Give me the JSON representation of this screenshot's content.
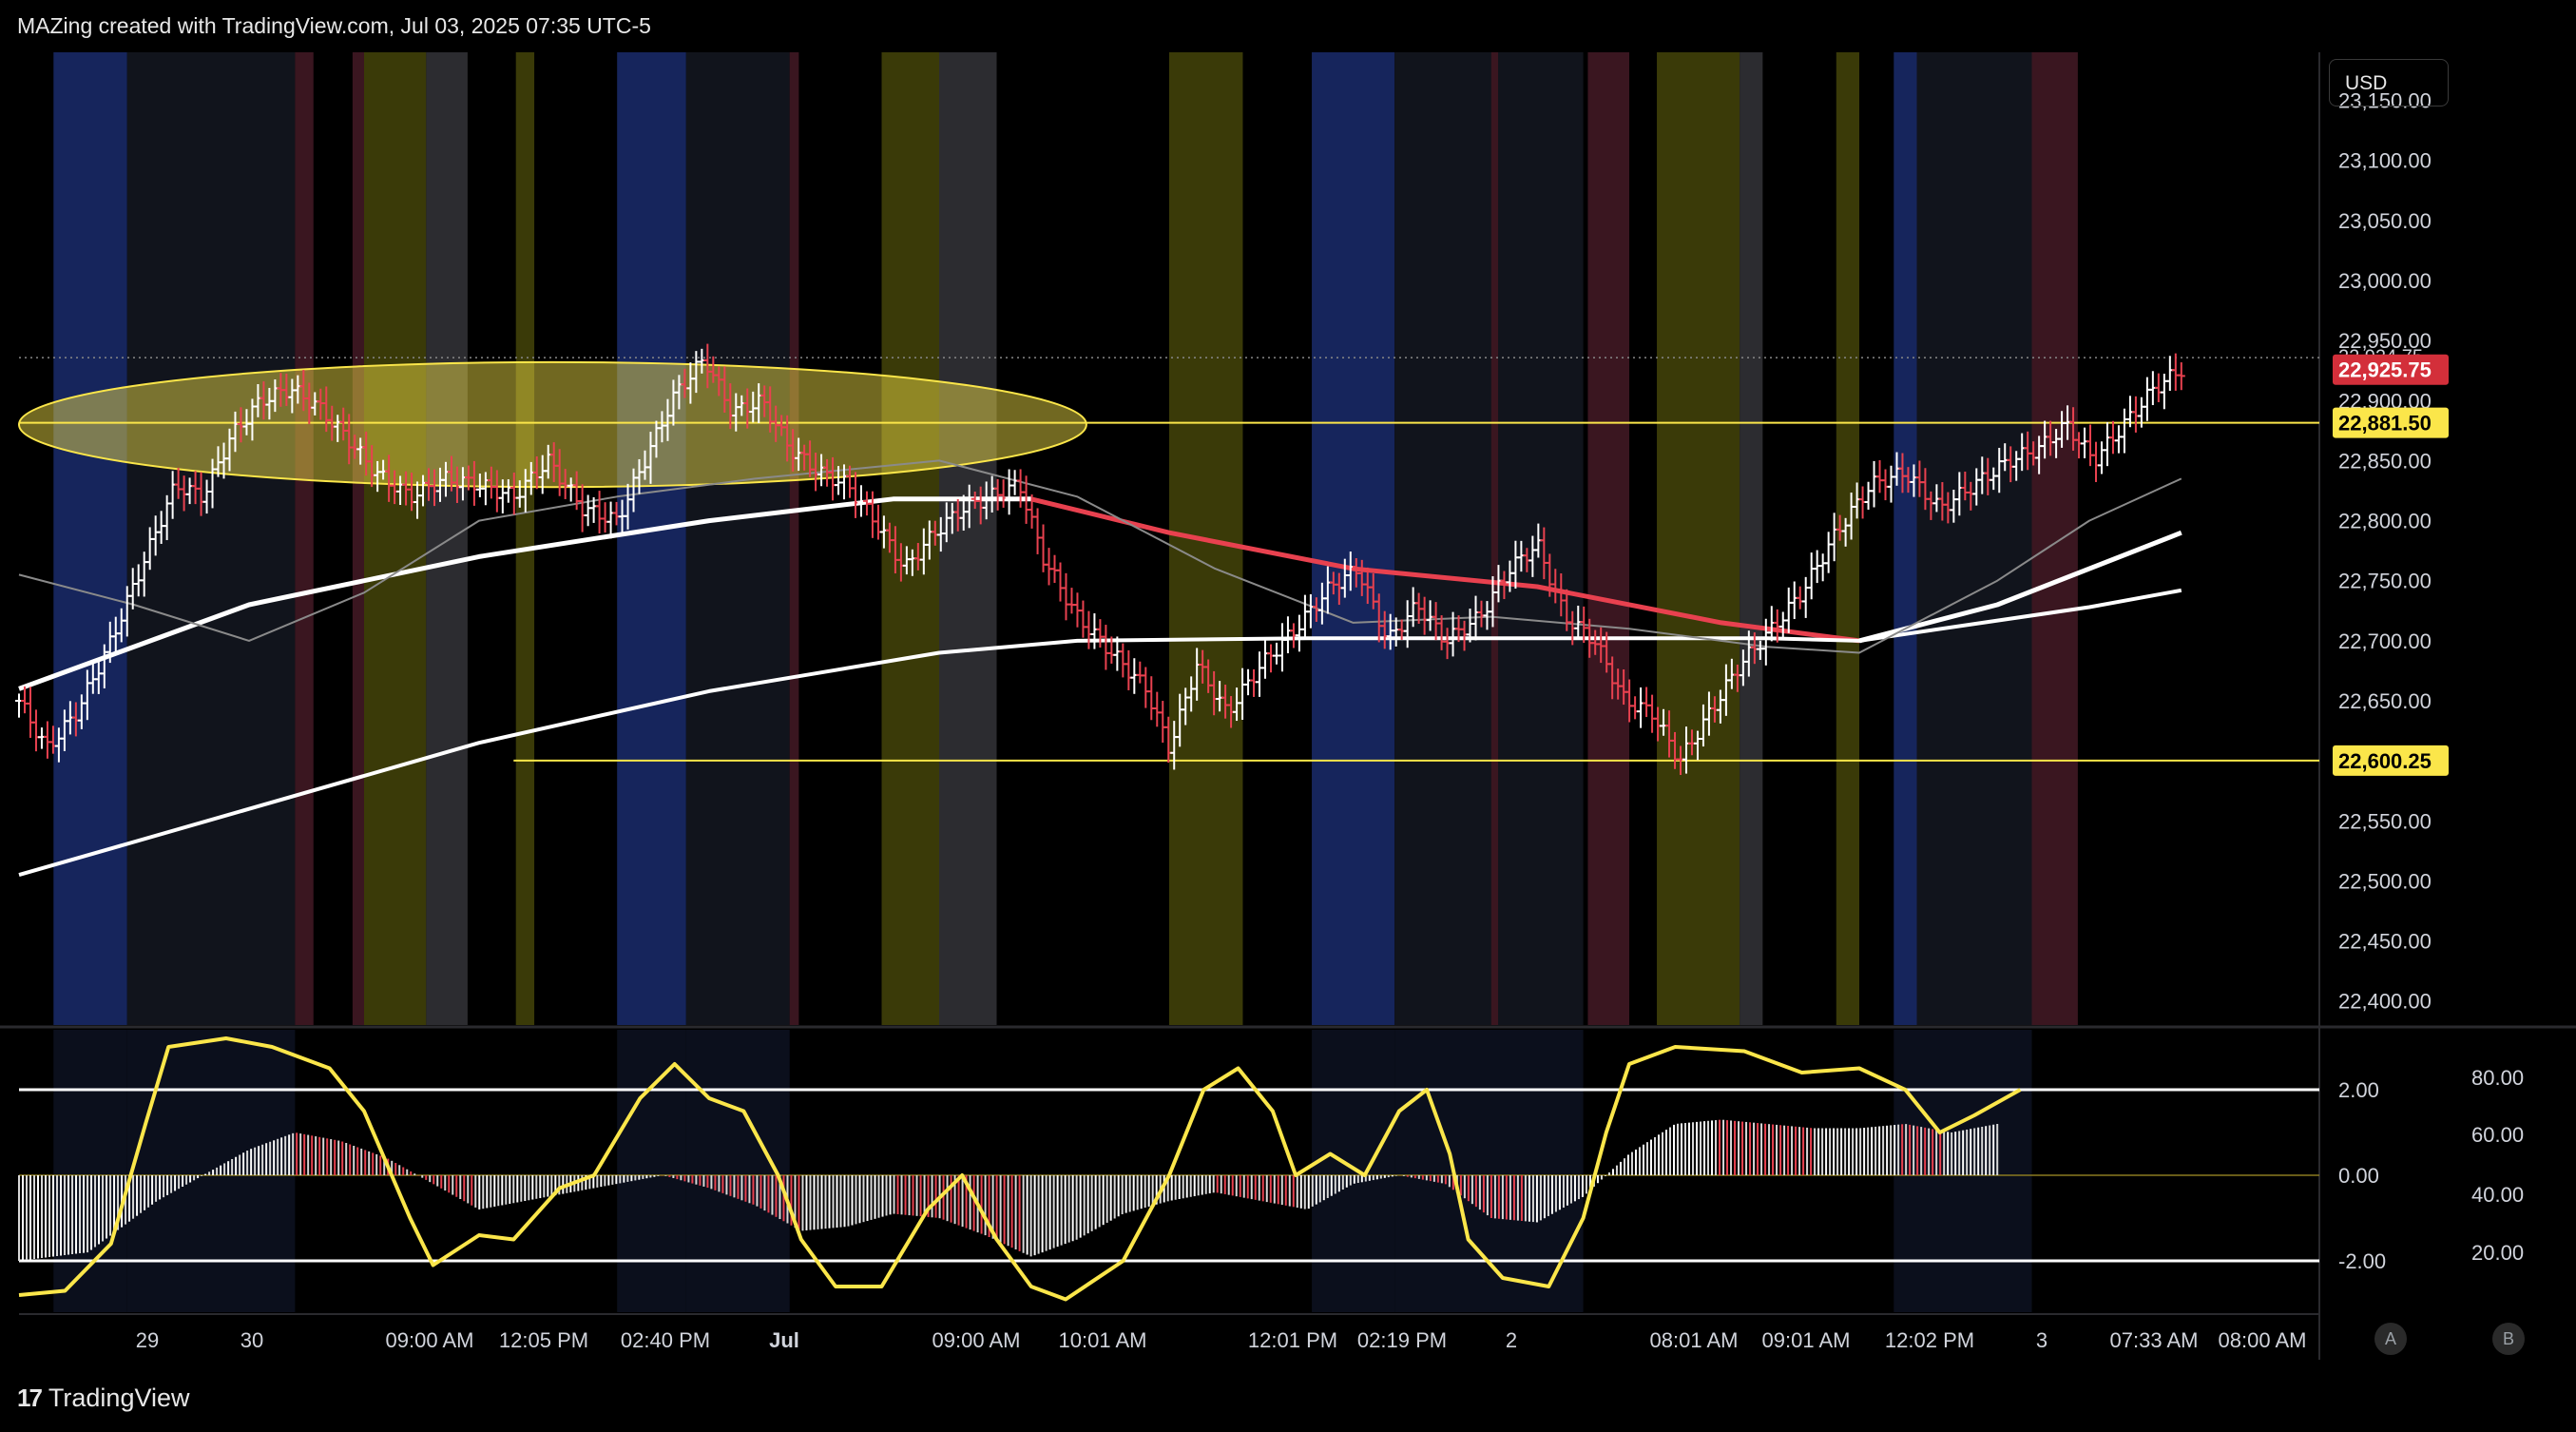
{
  "header": {
    "title": "MAZing created with TradingView.com, Jul 03, 2025 07:35 UTC-5"
  },
  "brand": {
    "name": "TradingView",
    "logo_icon": "tradingview-logo-icon"
  },
  "currency": "USD",
  "scale_buttons": [
    "A",
    "B"
  ],
  "colors": {
    "background": "#000000",
    "price_label_red": "#d32f3a",
    "price_label_yellow": "#fbe64a",
    "yellow": "#fbe64a",
    "red": "#e8414f",
    "white": "#ffffff",
    "blue_band": "#16255c",
    "yellow_band": "#3a3a08",
    "gray_band": "#2c2c30",
    "red_band": "#3a1620"
  },
  "chart_data": [
    {
      "type": "bar",
      "title": "",
      "description_note": "",
      "ylim": [
        22380,
        23190
      ],
      "y_ticks": [
        "23,150.00",
        "23,100.00",
        "23,050.00",
        "23,000.00",
        "22,950.00",
        "22,900.00",
        "22,850.00",
        "22,800.00",
        "22,750.00",
        "22,700.00",
        "22,650.00",
        "22,600.00",
        "22,550.00",
        "22,500.00",
        "22,450.00",
        "22,400.00"
      ],
      "x_ticks": [
        "29",
        "30",
        "09:00 AM",
        "12:05 PM",
        "02:40 PM",
        "Jul",
        "09:00 AM",
        "10:01 AM",
        "12:01 PM",
        "02:19 PM",
        "2",
        "08:01 AM",
        "09:01 AM",
        "12:02 PM",
        "3",
        "07:33 AM",
        "08:00 AM"
      ],
      "price_labels": [
        {
          "text": "22,925.75",
          "value": 22925.75,
          "style": "red"
        },
        {
          "text": "22,881.50",
          "value": 22881.5,
          "style": "yellow"
        },
        {
          "text": "22,600.25",
          "value": 22600.25,
          "style": "yellow"
        }
      ],
      "partial_label": "22,924.75",
      "last_price": 22925.75,
      "horizontal_levels": [
        22881.5,
        22600.25
      ],
      "price_series": [
        [
          0,
          22650
        ],
        [
          0.012,
          22610
        ],
        [
          0.025,
          22640
        ],
        [
          0.04,
          22700
        ],
        [
          0.055,
          22770
        ],
        [
          0.068,
          22830
        ],
        [
          0.08,
          22820
        ],
        [
          0.092,
          22870
        ],
        [
          0.105,
          22900
        ],
        [
          0.118,
          22910
        ],
        [
          0.13,
          22895
        ],
        [
          0.142,
          22870
        ],
        [
          0.155,
          22840
        ],
        [
          0.17,
          22820
        ],
        [
          0.185,
          22835
        ],
        [
          0.2,
          22830
        ],
        [
          0.215,
          22820
        ],
        [
          0.23,
          22850
        ],
        [
          0.245,
          22810
        ],
        [
          0.26,
          22800
        ],
        [
          0.272,
          22850
        ],
        [
          0.285,
          22905
        ],
        [
          0.298,
          22935
        ],
        [
          0.31,
          22890
        ],
        [
          0.323,
          22900
        ],
        [
          0.335,
          22860
        ],
        [
          0.348,
          22840
        ],
        [
          0.36,
          22830
        ],
        [
          0.372,
          22800
        ],
        [
          0.385,
          22760
        ],
        [
          0.398,
          22790
        ],
        [
          0.41,
          22810
        ],
        [
          0.422,
          22820
        ],
        [
          0.435,
          22830
        ],
        [
          0.445,
          22770
        ],
        [
          0.46,
          22720
        ],
        [
          0.475,
          22690
        ],
        [
          0.49,
          22660
        ],
        [
          0.5,
          22610
        ],
        [
          0.512,
          22680
        ],
        [
          0.525,
          22640
        ],
        [
          0.54,
          22680
        ],
        [
          0.555,
          22710
        ],
        [
          0.57,
          22745
        ],
        [
          0.582,
          22760
        ],
        [
          0.595,
          22700
        ],
        [
          0.608,
          22730
        ],
        [
          0.62,
          22700
        ],
        [
          0.635,
          22720
        ],
        [
          0.648,
          22760
        ],
        [
          0.66,
          22780
        ],
        [
          0.672,
          22720
        ],
        [
          0.685,
          22700
        ],
        [
          0.698,
          22650
        ],
        [
          0.71,
          22640
        ],
        [
          0.722,
          22600
        ],
        [
          0.735,
          22640
        ],
        [
          0.748,
          22680
        ],
        [
          0.762,
          22710
        ],
        [
          0.775,
          22740
        ],
        [
          0.79,
          22790
        ],
        [
          0.805,
          22830
        ],
        [
          0.82,
          22840
        ],
        [
          0.835,
          22810
        ],
        [
          0.85,
          22830
        ],
        [
          0.865,
          22850
        ],
        [
          0.878,
          22860
        ],
        [
          0.89,
          22880
        ],
        [
          0.902,
          22850
        ],
        [
          0.915,
          22880
        ],
        [
          0.928,
          22910
        ],
        [
          0.94,
          22926
        ]
      ],
      "lines": [
        {
          "name": "",
          "color": "white",
          "width": 5,
          "points": [
            [
              0,
              22660
            ],
            [
              0.1,
              22730
            ],
            [
              0.2,
              22770
            ],
            [
              0.3,
              22800
            ],
            [
              0.38,
              22818
            ],
            [
              0.44,
              22818
            ]
          ]
        },
        {
          "name": "",
          "color": "red",
          "width": 5,
          "points": [
            [
              0.44,
              22818
            ],
            [
              0.5,
              22790
            ],
            [
              0.58,
              22760
            ],
            [
              0.66,
              22745
            ],
            [
              0.74,
              22715
            ],
            [
              0.8,
              22700
            ]
          ]
        },
        {
          "name": "",
          "color": "white",
          "width": 5,
          "points": [
            [
              0.8,
              22700
            ],
            [
              0.86,
              22730
            ],
            [
              0.94,
              22790
            ]
          ]
        },
        {
          "name": "",
          "color": "white",
          "width": 4,
          "points": [
            [
              0,
              22505
            ],
            [
              0.1,
              22560
            ],
            [
              0.2,
              22615
            ],
            [
              0.3,
              22658
            ],
            [
              0.4,
              22690
            ],
            [
              0.46,
              22700
            ],
            [
              0.56,
              22702
            ],
            [
              0.66,
              22702
            ],
            [
              0.76,
              22702
            ],
            [
              0.8,
              22700
            ],
            [
              0.9,
              22728
            ],
            [
              0.94,
              22742
            ]
          ]
        },
        {
          "name": "",
          "color": "gray",
          "width": 2,
          "points": [
            [
              0,
              22755
            ],
            [
              0.05,
              22730
            ],
            [
              0.1,
              22700
            ],
            [
              0.15,
              22740
            ],
            [
              0.2,
              22800
            ],
            [
              0.26,
              22820
            ],
            [
              0.32,
              22835
            ],
            [
              0.4,
              22850
            ],
            [
              0.46,
              22820
            ],
            [
              0.52,
              22760
            ],
            [
              0.58,
              22715
            ],
            [
              0.64,
              22720
            ],
            [
              0.7,
              22710
            ],
            [
              0.76,
              22695
            ],
            [
              0.8,
              22690
            ],
            [
              0.86,
              22750
            ],
            [
              0.9,
              22800
            ],
            [
              0.94,
              22835
            ]
          ]
        }
      ],
      "bands": [
        {
          "from": 0.015,
          "to": 0.047,
          "color": "blue"
        },
        {
          "from": 0.047,
          "to": 0.12,
          "color": "dark"
        },
        {
          "from": 0.12,
          "to": 0.128,
          "color": "red"
        },
        {
          "from": 0.145,
          "to": 0.15,
          "color": "red"
        },
        {
          "from": 0.15,
          "to": 0.177,
          "color": "yellow"
        },
        {
          "from": 0.177,
          "to": 0.195,
          "color": "gray"
        },
        {
          "from": 0.216,
          "to": 0.224,
          "color": "yellow"
        },
        {
          "from": 0.26,
          "to": 0.29,
          "color": "blue"
        },
        {
          "from": 0.29,
          "to": 0.335,
          "color": "dark"
        },
        {
          "from": 0.335,
          "to": 0.339,
          "color": "red"
        },
        {
          "from": 0.375,
          "to": 0.4,
          "color": "yellow"
        },
        {
          "from": 0.4,
          "to": 0.425,
          "color": "gray"
        },
        {
          "from": 0.5,
          "to": 0.532,
          "color": "yellow"
        },
        {
          "from": 0.562,
          "to": 0.598,
          "color": "blue"
        },
        {
          "from": 0.598,
          "to": 0.68,
          "color": "dark"
        },
        {
          "from": 0.64,
          "to": 0.643,
          "color": "red"
        },
        {
          "from": 0.682,
          "to": 0.7,
          "color": "red"
        },
        {
          "from": 0.712,
          "to": 0.748,
          "color": "yellow"
        },
        {
          "from": 0.748,
          "to": 0.758,
          "color": "gray"
        },
        {
          "from": 0.79,
          "to": 0.8,
          "color": "yellow"
        },
        {
          "from": 0.815,
          "to": 0.825,
          "color": "blue"
        },
        {
          "from": 0.825,
          "to": 0.875,
          "color": "dark"
        },
        {
          "from": 0.875,
          "to": 0.895,
          "color": "red"
        }
      ],
      "ellipse": {
        "center_x": 0.232,
        "center_y": 22880,
        "radius_x": 0.232,
        "radius_y": 52
      }
    },
    {
      "type": "line",
      "title": "",
      "left_ticks": [
        "2.00",
        "0.00",
        "-2.00"
      ],
      "right_ticks": [
        "80.00",
        "60.00",
        "40.00",
        "20.00"
      ],
      "ylim": [
        -3.2,
        3.4
      ],
      "reference_levels": [
        2,
        -2
      ],
      "oscillator": [
        [
          0,
          -2.8
        ],
        [
          0.02,
          -2.7
        ],
        [
          0.04,
          -1.6
        ],
        [
          0.055,
          1.2
        ],
        [
          0.065,
          3.0
        ],
        [
          0.09,
          3.2
        ],
        [
          0.11,
          3.0
        ],
        [
          0.135,
          2.5
        ],
        [
          0.15,
          1.5
        ],
        [
          0.17,
          -1.0
        ],
        [
          0.18,
          -2.1
        ],
        [
          0.2,
          -1.4
        ],
        [
          0.215,
          -1.5
        ],
        [
          0.235,
          -0.3
        ],
        [
          0.25,
          0.0
        ],
        [
          0.27,
          1.8
        ],
        [
          0.285,
          2.6
        ],
        [
          0.3,
          1.8
        ],
        [
          0.315,
          1.5
        ],
        [
          0.33,
          0.0
        ],
        [
          0.34,
          -1.5
        ],
        [
          0.355,
          -2.6
        ],
        [
          0.375,
          -2.6
        ],
        [
          0.395,
          -0.8
        ],
        [
          0.41,
          0.0
        ],
        [
          0.425,
          -1.5
        ],
        [
          0.44,
          -2.6
        ],
        [
          0.455,
          -2.9
        ],
        [
          0.48,
          -2.0
        ],
        [
          0.5,
          0.0
        ],
        [
          0.515,
          2.0
        ],
        [
          0.53,
          2.5
        ],
        [
          0.545,
          1.5
        ],
        [
          0.555,
          0.0
        ],
        [
          0.57,
          0.5
        ],
        [
          0.585,
          0.0
        ],
        [
          0.6,
          1.5
        ],
        [
          0.612,
          2.0
        ],
        [
          0.622,
          0.5
        ],
        [
          0.63,
          -1.5
        ],
        [
          0.645,
          -2.4
        ],
        [
          0.665,
          -2.6
        ],
        [
          0.68,
          -1.0
        ],
        [
          0.69,
          1.0
        ],
        [
          0.7,
          2.6
        ],
        [
          0.72,
          3.0
        ],
        [
          0.75,
          2.9
        ],
        [
          0.775,
          2.4
        ],
        [
          0.8,
          2.5
        ],
        [
          0.82,
          2.0
        ],
        [
          0.835,
          1.0
        ],
        [
          0.85,
          1.4
        ],
        [
          0.87,
          2.0
        ]
      ],
      "histogram": [
        [
          0,
          -2.0
        ],
        [
          0.03,
          -1.8
        ],
        [
          0.06,
          -0.6
        ],
        [
          0.08,
          0.0
        ],
        [
          0.1,
          0.6
        ],
        [
          0.12,
          1.0
        ],
        [
          0.14,
          0.8
        ],
        [
          0.16,
          0.4
        ],
        [
          0.18,
          -0.2
        ],
        [
          0.2,
          -0.8
        ],
        [
          0.22,
          -0.6
        ],
        [
          0.24,
          -0.4
        ],
        [
          0.26,
          -0.2
        ],
        [
          0.28,
          0.0
        ],
        [
          0.3,
          -0.3
        ],
        [
          0.32,
          -0.7
        ],
        [
          0.34,
          -1.3
        ],
        [
          0.36,
          -1.2
        ],
        [
          0.38,
          -0.9
        ],
        [
          0.4,
          -1.0
        ],
        [
          0.42,
          -1.4
        ],
        [
          0.44,
          -1.9
        ],
        [
          0.46,
          -1.5
        ],
        [
          0.48,
          -0.9
        ],
        [
          0.5,
          -0.6
        ],
        [
          0.52,
          -0.4
        ],
        [
          0.54,
          -0.6
        ],
        [
          0.56,
          -0.8
        ],
        [
          0.58,
          -0.2
        ],
        [
          0.6,
          0.0
        ],
        [
          0.62,
          -0.2
        ],
        [
          0.64,
          -1.0
        ],
        [
          0.66,
          -1.1
        ],
        [
          0.68,
          -0.5
        ],
        [
          0.7,
          0.5
        ],
        [
          0.72,
          1.2
        ],
        [
          0.74,
          1.3
        ],
        [
          0.76,
          1.2
        ],
        [
          0.78,
          1.1
        ],
        [
          0.8,
          1.1
        ],
        [
          0.82,
          1.2
        ],
        [
          0.84,
          1.0
        ],
        [
          0.86,
          1.2
        ]
      ]
    }
  ]
}
